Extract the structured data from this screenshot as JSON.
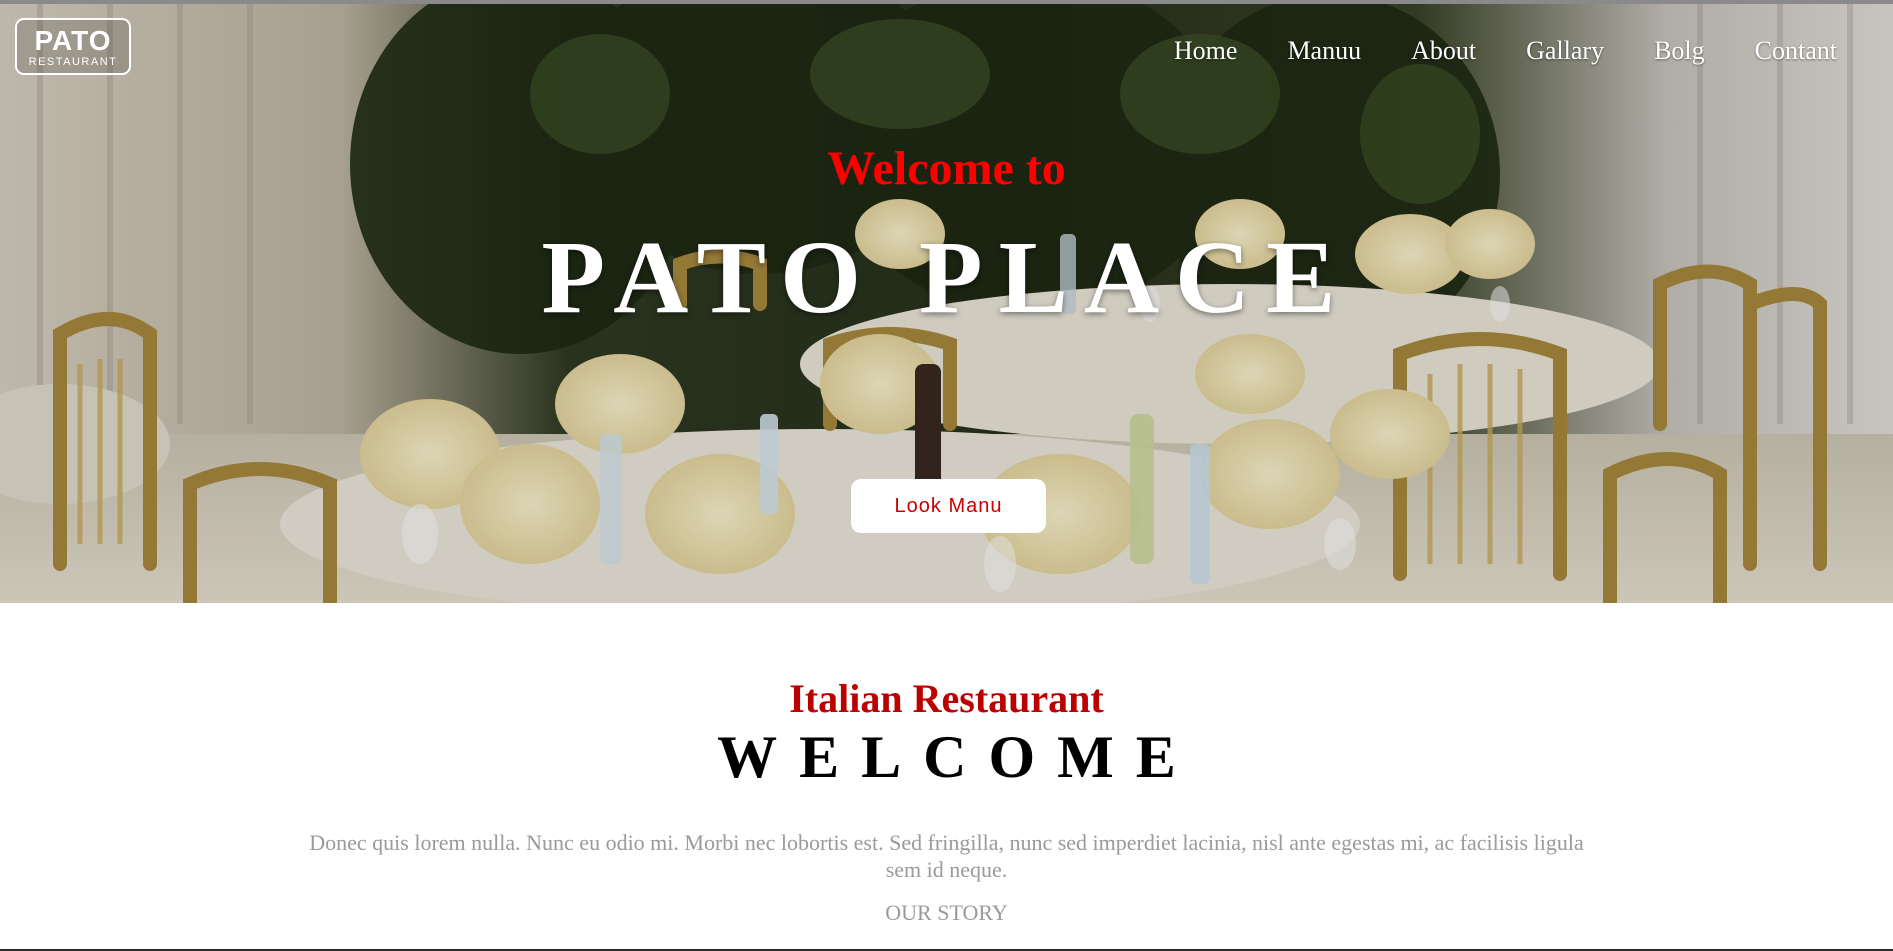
{
  "logo": {
    "main": "PATO",
    "sub": "RESTAURANT"
  },
  "nav": {
    "items": [
      "Home",
      "Manuu",
      "About",
      "Gallary",
      "Bolg",
      "Contant"
    ]
  },
  "hero": {
    "kicker": "Welcome to",
    "title": "PATO PLACE",
    "button_label": "Look Manu",
    "image": "restaurant-banquet-tables-photo"
  },
  "intro": {
    "kicker": "Italian Restaurant",
    "title": "WELCOME",
    "text": "Donec quis lorem nulla. Nunc eu odio mi. Morbi nec lobortis est. Sed fringilla, nunc sed imperdiet lacinia, nisl ante egestas mi, ac facilisis ligula sem id neque.",
    "link": "OUR STORY"
  },
  "colors": {
    "accent_red": "#ff0000",
    "kicker_red": "#bb0000",
    "muted_text": "#9a9a9a",
    "hero_text": "#ffffff"
  }
}
